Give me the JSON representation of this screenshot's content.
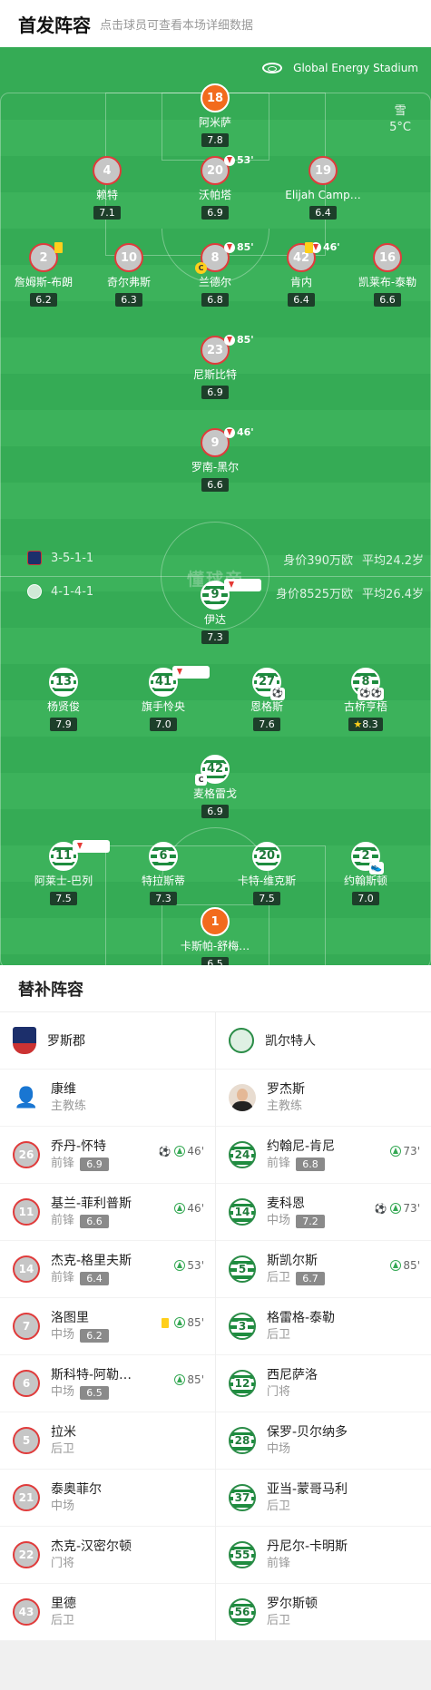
{
  "header": {
    "title": "首发阵容",
    "subtitle": "点击球员可查看本场详细数据"
  },
  "pitch": {
    "stadium": "Global Energy Stadium",
    "weather": "雪",
    "temperature": "5°C",
    "watermark": "懂球帝",
    "home": {
      "formation": "3-5-1-1",
      "value": "身价390万欧",
      "age": "平均24.2岁"
    },
    "away": {
      "formation": "4-1-4-1",
      "value": "身价8525万欧",
      "age": "平均26.4岁"
    },
    "home_players": [
      {
        "num": "18",
        "name": "阿米萨",
        "rating": "7.8",
        "gk": true
      },
      {
        "num": "4",
        "name": "赖特",
        "rating": "7.1"
      },
      {
        "num": "20",
        "name": "沃帕塔",
        "rating": "6.9",
        "sub": "53'"
      },
      {
        "num": "19",
        "name": "Elijah Camp…",
        "rating": "6.4"
      },
      {
        "num": "2",
        "name": "詹姆斯-布朗",
        "rating": "6.2",
        "card": "yellow"
      },
      {
        "num": "10",
        "name": "奇尔弗斯",
        "rating": "6.3"
      },
      {
        "num": "8",
        "name": "兰德尔",
        "rating": "6.8",
        "sub": "85'",
        "captain": true
      },
      {
        "num": "42",
        "name": "肯内",
        "rating": "6.4",
        "sub": "46'",
        "card": "yellow"
      },
      {
        "num": "16",
        "name": "凯莱布-泰勒",
        "rating": "6.6"
      },
      {
        "num": "23",
        "name": "尼斯比特",
        "rating": "6.9",
        "sub": "85'"
      },
      {
        "num": "9",
        "name": "罗南-黑尔",
        "rating": "6.6",
        "sub": "46'"
      }
    ],
    "away_players": [
      {
        "num": "9",
        "name": "伊达",
        "rating": "7.3",
        "sub": "73'"
      },
      {
        "num": "13",
        "name": "杨贤俊",
        "rating": "7.9"
      },
      {
        "num": "41",
        "name": "旗手怜央",
        "rating": "7.0",
        "sub": "73'"
      },
      {
        "num": "27",
        "name": "恩格斯",
        "rating": "7.6",
        "goal": "⚽"
      },
      {
        "num": "8",
        "name": "古桥亨梧",
        "rating": "8.3",
        "goal": "⚽⚽",
        "star": true
      },
      {
        "num": "42",
        "name": "麦格雷戈",
        "rating": "6.9",
        "captain": true
      },
      {
        "num": "11",
        "name": "阿莱士-巴列",
        "rating": "7.5",
        "sub": "85'"
      },
      {
        "num": "6",
        "name": "特拉斯蒂",
        "rating": "7.3"
      },
      {
        "num": "20",
        "name": "卡特-维克斯",
        "rating": "7.5"
      },
      {
        "num": "2",
        "name": "约翰斯顿",
        "rating": "7.0",
        "goal": "👟"
      },
      {
        "num": "1",
        "name": "卡斯帕-舒梅…",
        "rating": "6.5",
        "gk": true
      }
    ]
  },
  "subs": {
    "title": "替补阵容",
    "home": {
      "team": "罗斯郡",
      "coach": {
        "name": "康维",
        "role": "主教练"
      },
      "players": [
        {
          "num": "26",
          "name": "乔丹-怀特",
          "pos": "前锋",
          "rating": "6.9",
          "goal": "⚽",
          "time": "46'"
        },
        {
          "num": "11",
          "name": "基兰-菲利普斯",
          "pos": "前锋",
          "rating": "6.6",
          "time": "46'"
        },
        {
          "num": "14",
          "name": "杰克-格里夫斯",
          "pos": "前锋",
          "rating": "6.4",
          "time": "53'"
        },
        {
          "num": "7",
          "name": "洛图里",
          "pos": "中场",
          "rating": "6.2",
          "card": "yellow",
          "time": "85'"
        },
        {
          "num": "6",
          "name": "斯科特-阿勒…",
          "pos": "中场",
          "rating": "6.5",
          "time": "85'"
        },
        {
          "num": "5",
          "name": "拉米",
          "pos": "后卫"
        },
        {
          "num": "21",
          "name": "泰奥菲尔",
          "pos": "中场"
        },
        {
          "num": "22",
          "name": "杰克-汉密尔顿",
          "pos": "门将"
        },
        {
          "num": "43",
          "name": "里德",
          "pos": "后卫"
        }
      ]
    },
    "away": {
      "team": "凯尔特人",
      "coach": {
        "name": "罗杰斯",
        "role": "主教练"
      },
      "players": [
        {
          "num": "24",
          "name": "约翰尼-肯尼",
          "pos": "前锋",
          "rating": "6.8",
          "time": "73'"
        },
        {
          "num": "14",
          "name": "麦科恩",
          "pos": "中场",
          "rating": "7.2",
          "goal": "⚽",
          "time": "73'"
        },
        {
          "num": "5",
          "name": "斯凯尔斯",
          "pos": "后卫",
          "rating": "6.7",
          "time": "85'"
        },
        {
          "num": "3",
          "name": "格雷格-泰勒",
          "pos": "后卫"
        },
        {
          "num": "12",
          "name": "西尼萨洛",
          "pos": "门将"
        },
        {
          "num": "28",
          "name": "保罗-贝尔纳多",
          "pos": "中场"
        },
        {
          "num": "37",
          "name": "亚当-蒙哥马利",
          "pos": "后卫"
        },
        {
          "num": "55",
          "name": "丹尼尔-卡明斯",
          "pos": "前锋"
        },
        {
          "num": "56",
          "name": "罗尔斯顿",
          "pos": "后卫"
        }
      ]
    }
  },
  "colors": {
    "pitch": "#35ab55",
    "gk": "#f26b1d",
    "ross_border": "#e03b3b",
    "celtic": "#1e8c3f"
  }
}
